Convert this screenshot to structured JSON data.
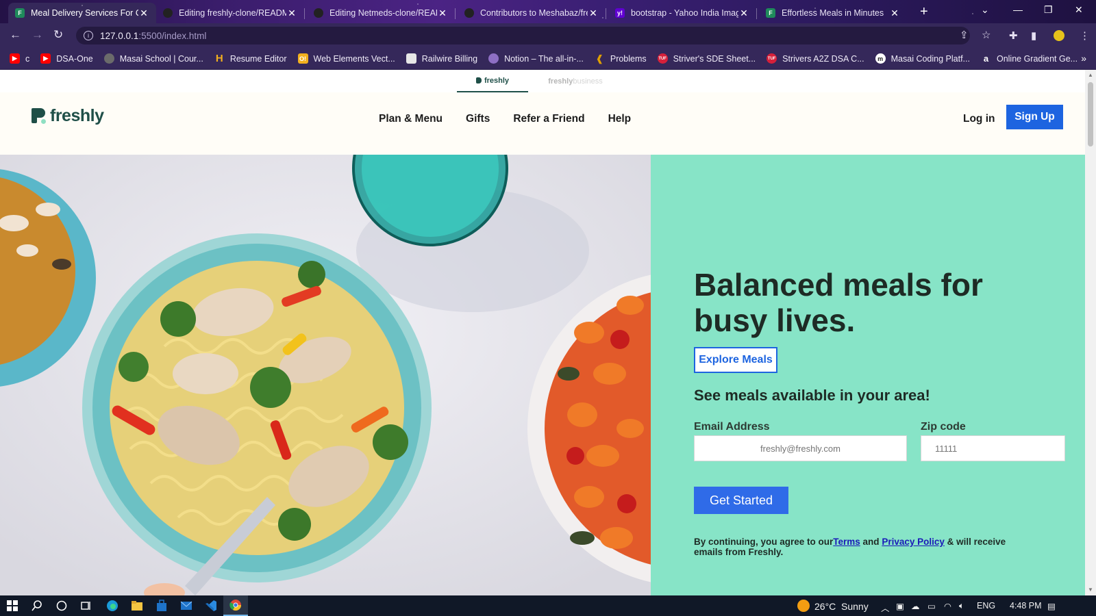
{
  "browser": {
    "tabs": [
      {
        "title": "Meal Delivery Services For Of",
        "favicon": "freshly-icon",
        "color": "#1f8a5b",
        "active": true
      },
      {
        "title": "Editing freshly-clone/READM",
        "favicon": "github-icon",
        "color": "#222222",
        "active": false
      },
      {
        "title": "Editing Netmeds-clone/READ",
        "favicon": "github-icon",
        "color": "#222222",
        "active": false
      },
      {
        "title": "Contributors to Meshabaz/fre",
        "favicon": "github-icon",
        "color": "#222222",
        "active": false
      },
      {
        "title": "bootstrap - Yahoo India Imag",
        "favicon": "yahoo-icon",
        "color": "#6001d2",
        "active": false
      },
      {
        "title": "Effortless Meals in Minutes",
        "favicon": "freshly-icon",
        "color": "#1f8a5b",
        "active": false
      }
    ],
    "url_host": "127.0.0.1",
    "url_path": ":5500/index.html",
    "bookmarks": [
      {
        "label": "c",
        "icon": "youtube-icon",
        "color": "#ff0000"
      },
      {
        "label": "DSA-One",
        "icon": "youtube-icon",
        "color": "#ff0000"
      },
      {
        "label": "Masai School | Cour...",
        "icon": "globe-icon",
        "color": "#777777"
      },
      {
        "label": "Resume Editor",
        "icon": "h-icon",
        "color": "#f2b01e"
      },
      {
        "label": "Web Elements Vect...",
        "icon": "o-icon",
        "color": "#f2b01e"
      },
      {
        "label": "Railwire Billing",
        "icon": "page-icon",
        "color": "#9e9e9e"
      },
      {
        "label": "Notion – The all-in-...",
        "icon": "notion-icon",
        "color": "#8e6fc4"
      },
      {
        "label": "Problems",
        "icon": "leetcode-icon",
        "color": "#e0a000"
      },
      {
        "label": "Striver's SDE Sheet...",
        "icon": "tuf-icon",
        "color": "#d6203a"
      },
      {
        "label": "Strivers A2Z DSA C...",
        "icon": "tuf-icon",
        "color": "#d6203a"
      },
      {
        "label": "Masai Coding Platf...",
        "icon": "m-icon",
        "color": "#ffffff"
      },
      {
        "label": "Online Gradient Ge...",
        "icon": "a-icon",
        "color": "#ffffff"
      }
    ]
  },
  "page": {
    "brand_tabs": {
      "freshly": "freshly",
      "business_a": "freshly",
      "business_b": "business"
    },
    "logo": "freshly",
    "nav": [
      "Plan & Menu",
      "Gifts",
      "Refer a Friend",
      "Help"
    ],
    "login": "Log in",
    "signup": "Sign Up",
    "headline": "Balanced meals for busy lives.",
    "explore": "Explore Meals",
    "subhead": "See meals available in your area!",
    "email_label": "Email Address",
    "email_placeholder": "freshly@freshly.com",
    "zip_label": "Zip code",
    "zip_placeholder": "11111",
    "cta": "Get Started",
    "legal_pre": "By continuing, you agree to our",
    "legal_terms": "Terms",
    "legal_and": " and ",
    "legal_privacy": "Privacy Policy",
    "legal_post": " & will receive emails from Freshly.",
    "colors": {
      "brand": "#1f4f48",
      "accent_blue": "#1d64e0",
      "panel": "#87e4c7"
    }
  },
  "taskbar": {
    "weather_temp": "26°C",
    "weather_text": "Sunny",
    "lang": "ENG",
    "time": "4:48 PM"
  }
}
